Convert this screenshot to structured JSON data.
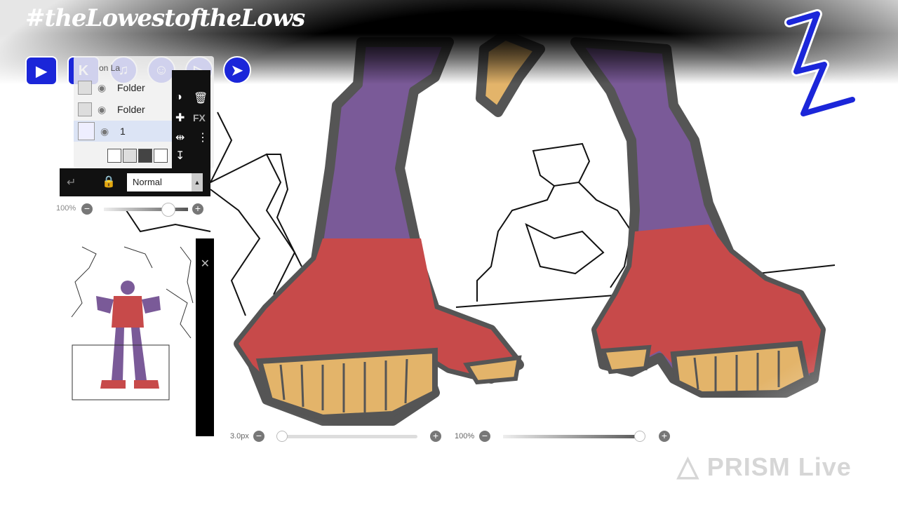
{
  "overlay": {
    "hashtag": "#theLowestoftheLows",
    "social_icons": [
      "youtube-icon",
      "kick-icon",
      "tiktok-icon",
      "snapchat-icon",
      "rumble-icon",
      "telegram-icon"
    ],
    "brand_color": "#1b26d9",
    "watermark": "PRISM Live"
  },
  "layers_panel": {
    "hidden_label": "on La",
    "layers": [
      {
        "name": "Folder"
      },
      {
        "name": "Folder"
      },
      {
        "name": "1",
        "selected": true
      }
    ],
    "fx_label": "FX"
  },
  "blend": {
    "mode": "Normal"
  },
  "opacity": {
    "value_label": "100%",
    "value": 0.76
  },
  "brush": {
    "size_label": "3.0px",
    "size": 0.03,
    "opacity_label": "100%",
    "opacity": 0.97
  },
  "colors": {
    "skin_purple": "#7a5a98",
    "boot_red": "#c74a4a",
    "gold": "#e3b46a"
  }
}
